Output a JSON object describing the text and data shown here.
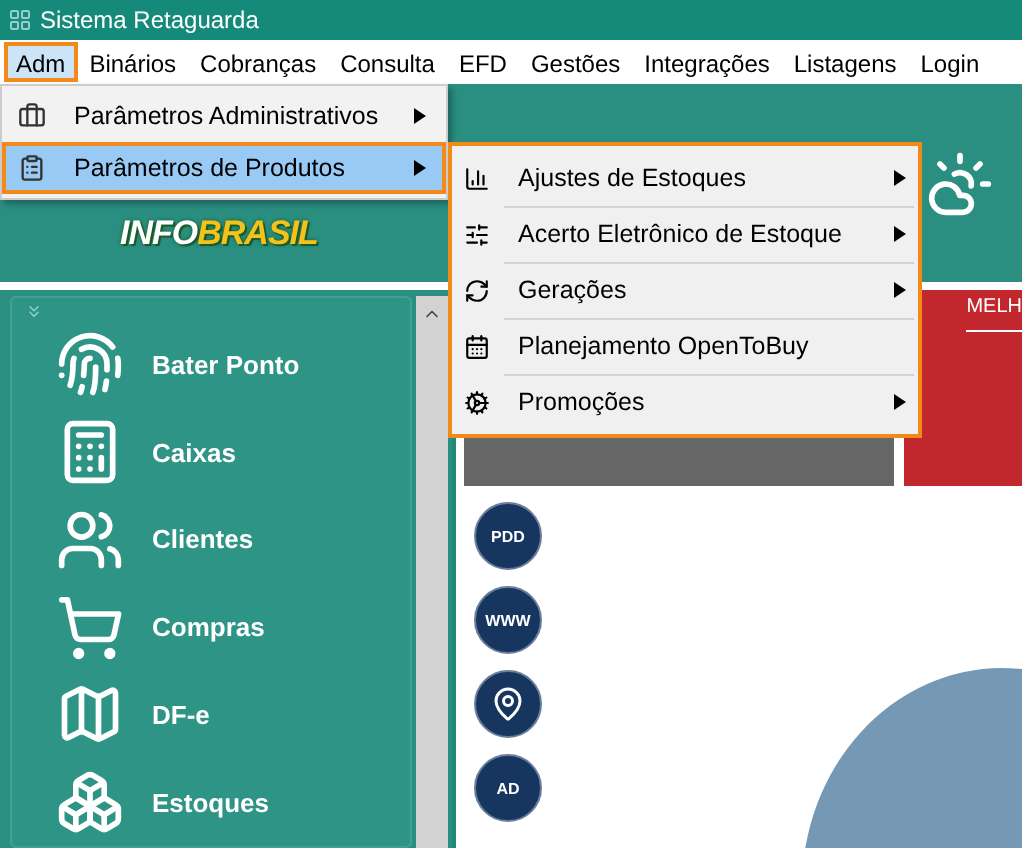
{
  "window": {
    "title": "Sistema Retaguarda"
  },
  "menubar": [
    {
      "label": "Adm",
      "selected": true
    },
    {
      "label": "Binários",
      "selected": false
    },
    {
      "label": "Cobranças",
      "selected": false
    },
    {
      "label": "Consulta",
      "selected": false
    },
    {
      "label": "EFD",
      "selected": false
    },
    {
      "label": "Gestões",
      "selected": false
    },
    {
      "label": "Integrações",
      "selected": false
    },
    {
      "label": "Listagens",
      "selected": false
    },
    {
      "label": "Login",
      "selected": false
    }
  ],
  "menu": {
    "items": [
      {
        "label": "Parâmetros Administrativos",
        "kind": "admin",
        "selected": false,
        "has_submenu": true
      },
      {
        "label": "Parâmetros de Produtos",
        "kind": "products",
        "selected": true,
        "has_submenu": true
      }
    ]
  },
  "submenu": {
    "items": [
      {
        "label": "Ajustes de Estoques",
        "kind": "chart",
        "has_submenu": true
      },
      {
        "label": "Acerto Eletrônico de Estoque",
        "kind": "sliders",
        "has_submenu": true
      },
      {
        "label": "Gerações",
        "kind": "refresh",
        "has_submenu": true
      },
      {
        "label": "Planejamento OpenToBuy",
        "kind": "plan",
        "has_submenu": false
      },
      {
        "label": "Promoções",
        "kind": "gear",
        "has_submenu": true
      }
    ]
  },
  "logo": {
    "part_1": "INFO",
    "part_2": "BRASIL"
  },
  "sidebar": {
    "items": [
      {
        "label": "Bater Ponto",
        "kind": "fingerprint"
      },
      {
        "label": "Caixas",
        "kind": "register"
      },
      {
        "label": "Clientes",
        "kind": "users"
      },
      {
        "label": "Compras",
        "kind": "cart"
      },
      {
        "label": "DF-e",
        "kind": "map"
      },
      {
        "label": "Estoques",
        "kind": "boxes"
      }
    ]
  },
  "banner": {
    "text": "MELH"
  },
  "shortcuts": [
    {
      "kind": "network",
      "label": "PDD"
    },
    {
      "kind": "globe",
      "label": "WWW"
    },
    {
      "kind": "pin"
    },
    {
      "kind": "tag",
      "label": "AD"
    }
  ]
}
